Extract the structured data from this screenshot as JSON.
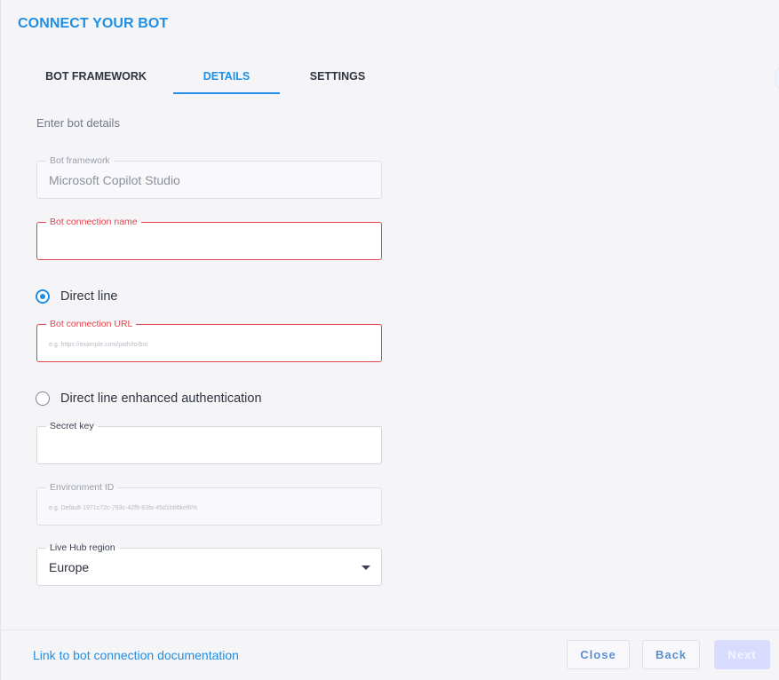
{
  "header": {
    "title": "CONNECT YOUR BOT"
  },
  "tabs": [
    {
      "label": "BOT FRAMEWORK",
      "active": false
    },
    {
      "label": "DETAILS",
      "active": true
    },
    {
      "label": "SETTINGS",
      "active": false
    }
  ],
  "form": {
    "subtitle": "Enter bot details",
    "bot_framework": {
      "label": "Bot framework",
      "value": "Microsoft Copilot Studio"
    },
    "bot_connection_name": {
      "label": "Bot connection name",
      "value": ""
    },
    "direct_line": {
      "label": "Direct line",
      "checked": true
    },
    "bot_connection_url": {
      "label": "Bot connection URL",
      "placeholder": "e.g. https://example.com/path/to/bot"
    },
    "direct_line_enhanced": {
      "label": "Direct line enhanced authentication",
      "checked": false
    },
    "secret_key": {
      "label": "Secret key",
      "value": ""
    },
    "environment_id": {
      "label": "Environment ID",
      "placeholder": "e.g. Default-1971c72c-793c-42f9-83fa-45d1b86kef8%"
    },
    "live_hub_region": {
      "label": "Live Hub region",
      "value": "Europe"
    }
  },
  "footer": {
    "doc_link": "Link to bot connection documentation",
    "close_label": "Close",
    "back_label": "Back",
    "next_label": "Next"
  },
  "colors": {
    "accent": "#1f8ee3",
    "error": "#e2464c",
    "next_disabled": "#d9dcff"
  }
}
